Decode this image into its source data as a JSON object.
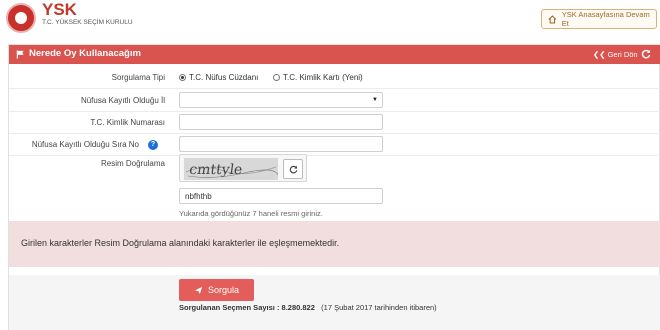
{
  "header": {
    "brand_title": "YSK",
    "brand_subtitle": "T.C. YÜKSEK SEÇİM KURULU",
    "home_button_label": "YSK Anasayfasına Devam Et",
    "home_icon": "home-icon"
  },
  "panel": {
    "title": "Nerede Oy Kullanacağım",
    "back_label": "Geri Dön",
    "flag_icon": "flag-icon",
    "refresh_icon": "refresh-icon",
    "accent_color": "#d9534f"
  },
  "form": {
    "query_type_label": "Sorgulama Tipi",
    "query_type_options": [
      "T.C. Nüfus Cüzdanı",
      "T.C. Kimlik Kartı (Yeni)"
    ],
    "query_type_selected": "T.C. Nüfus Cüzdanı",
    "province_label": "Nüfusa Kayıtlı Olduğu İl",
    "province_value": "",
    "tc_no_label": "T.C. Kimlik Numarası",
    "tc_no_value": "",
    "seq_no_label": "Nüfusa Kayıtlı Olduğu Sıra No",
    "seq_no_value": "",
    "help_icon": "question-icon",
    "captcha_label": "Resim Doğrulama",
    "captcha_image_text": "cmttyle",
    "captcha_value": "nbfhthb",
    "captcha_hint": "Yukarıda gördüğünüz 7 haneli resmi giriniz."
  },
  "alert": {
    "text": "Girilen karakterler Resim Doğrulama alanındaki karakterler ile eşleşmemektedir.",
    "background": "#f2dede"
  },
  "footer": {
    "submit_label": "Sorgula",
    "submit_color": "#e35d5b",
    "stats_label": "Sorgulanan Seçmen Sayısı : 8.280.822",
    "stats_note": "(17 Şubat 2017 tarihinden itibaren)"
  }
}
